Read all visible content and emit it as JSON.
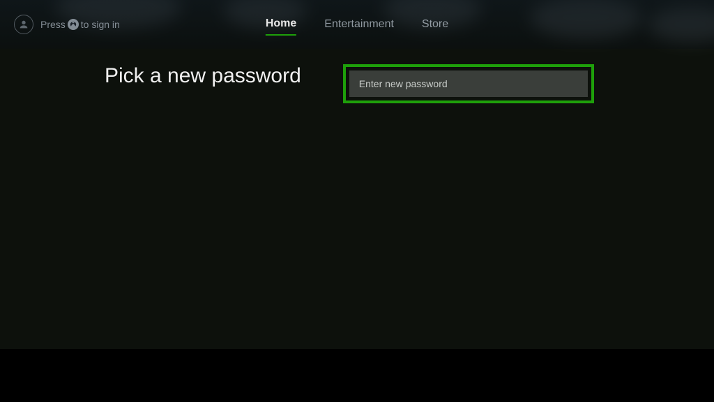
{
  "header": {
    "signin_prefix": "Press",
    "signin_suffix": "to sign in",
    "nav": [
      {
        "label": "Home",
        "active": true
      },
      {
        "label": "Entertainment",
        "active": false
      },
      {
        "label": "Store",
        "active": false
      }
    ]
  },
  "main": {
    "title": "Pick a new password",
    "password_placeholder": "Enter new password"
  },
  "colors": {
    "accent": "#1ea00a"
  }
}
